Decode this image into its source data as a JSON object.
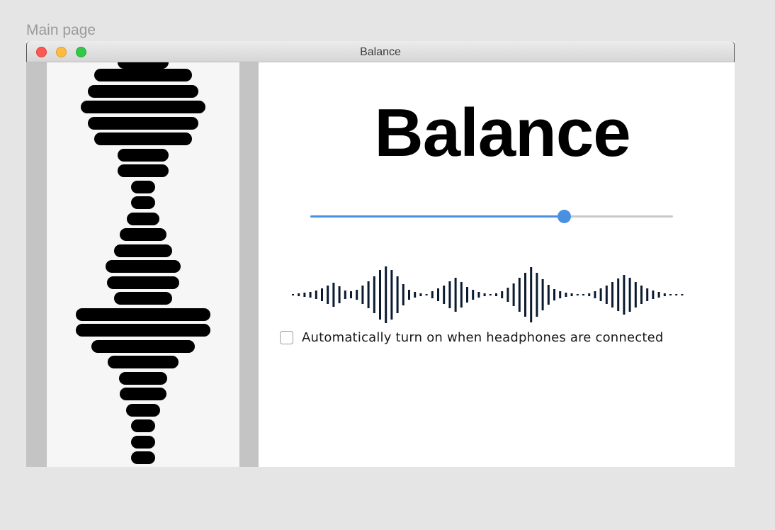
{
  "page": {
    "label": "Main page"
  },
  "window": {
    "title": "Balance"
  },
  "main": {
    "heading": "Balance",
    "balance_slider": {
      "value": 0.7,
      "accent_color": "#4a90e2",
      "track_color": "#c8c8c8"
    },
    "waveform_icon": "audio-waveform-icon",
    "auto_enable": {
      "label": "Automatically turn on when headphones are connected",
      "checked": false
    }
  },
  "sidebar": {
    "graphic_icon": "vertical-sound-wave-icon"
  },
  "colors": {
    "close": "#fc5753",
    "minimize": "#fdbc40",
    "maximize": "#34c84a"
  }
}
